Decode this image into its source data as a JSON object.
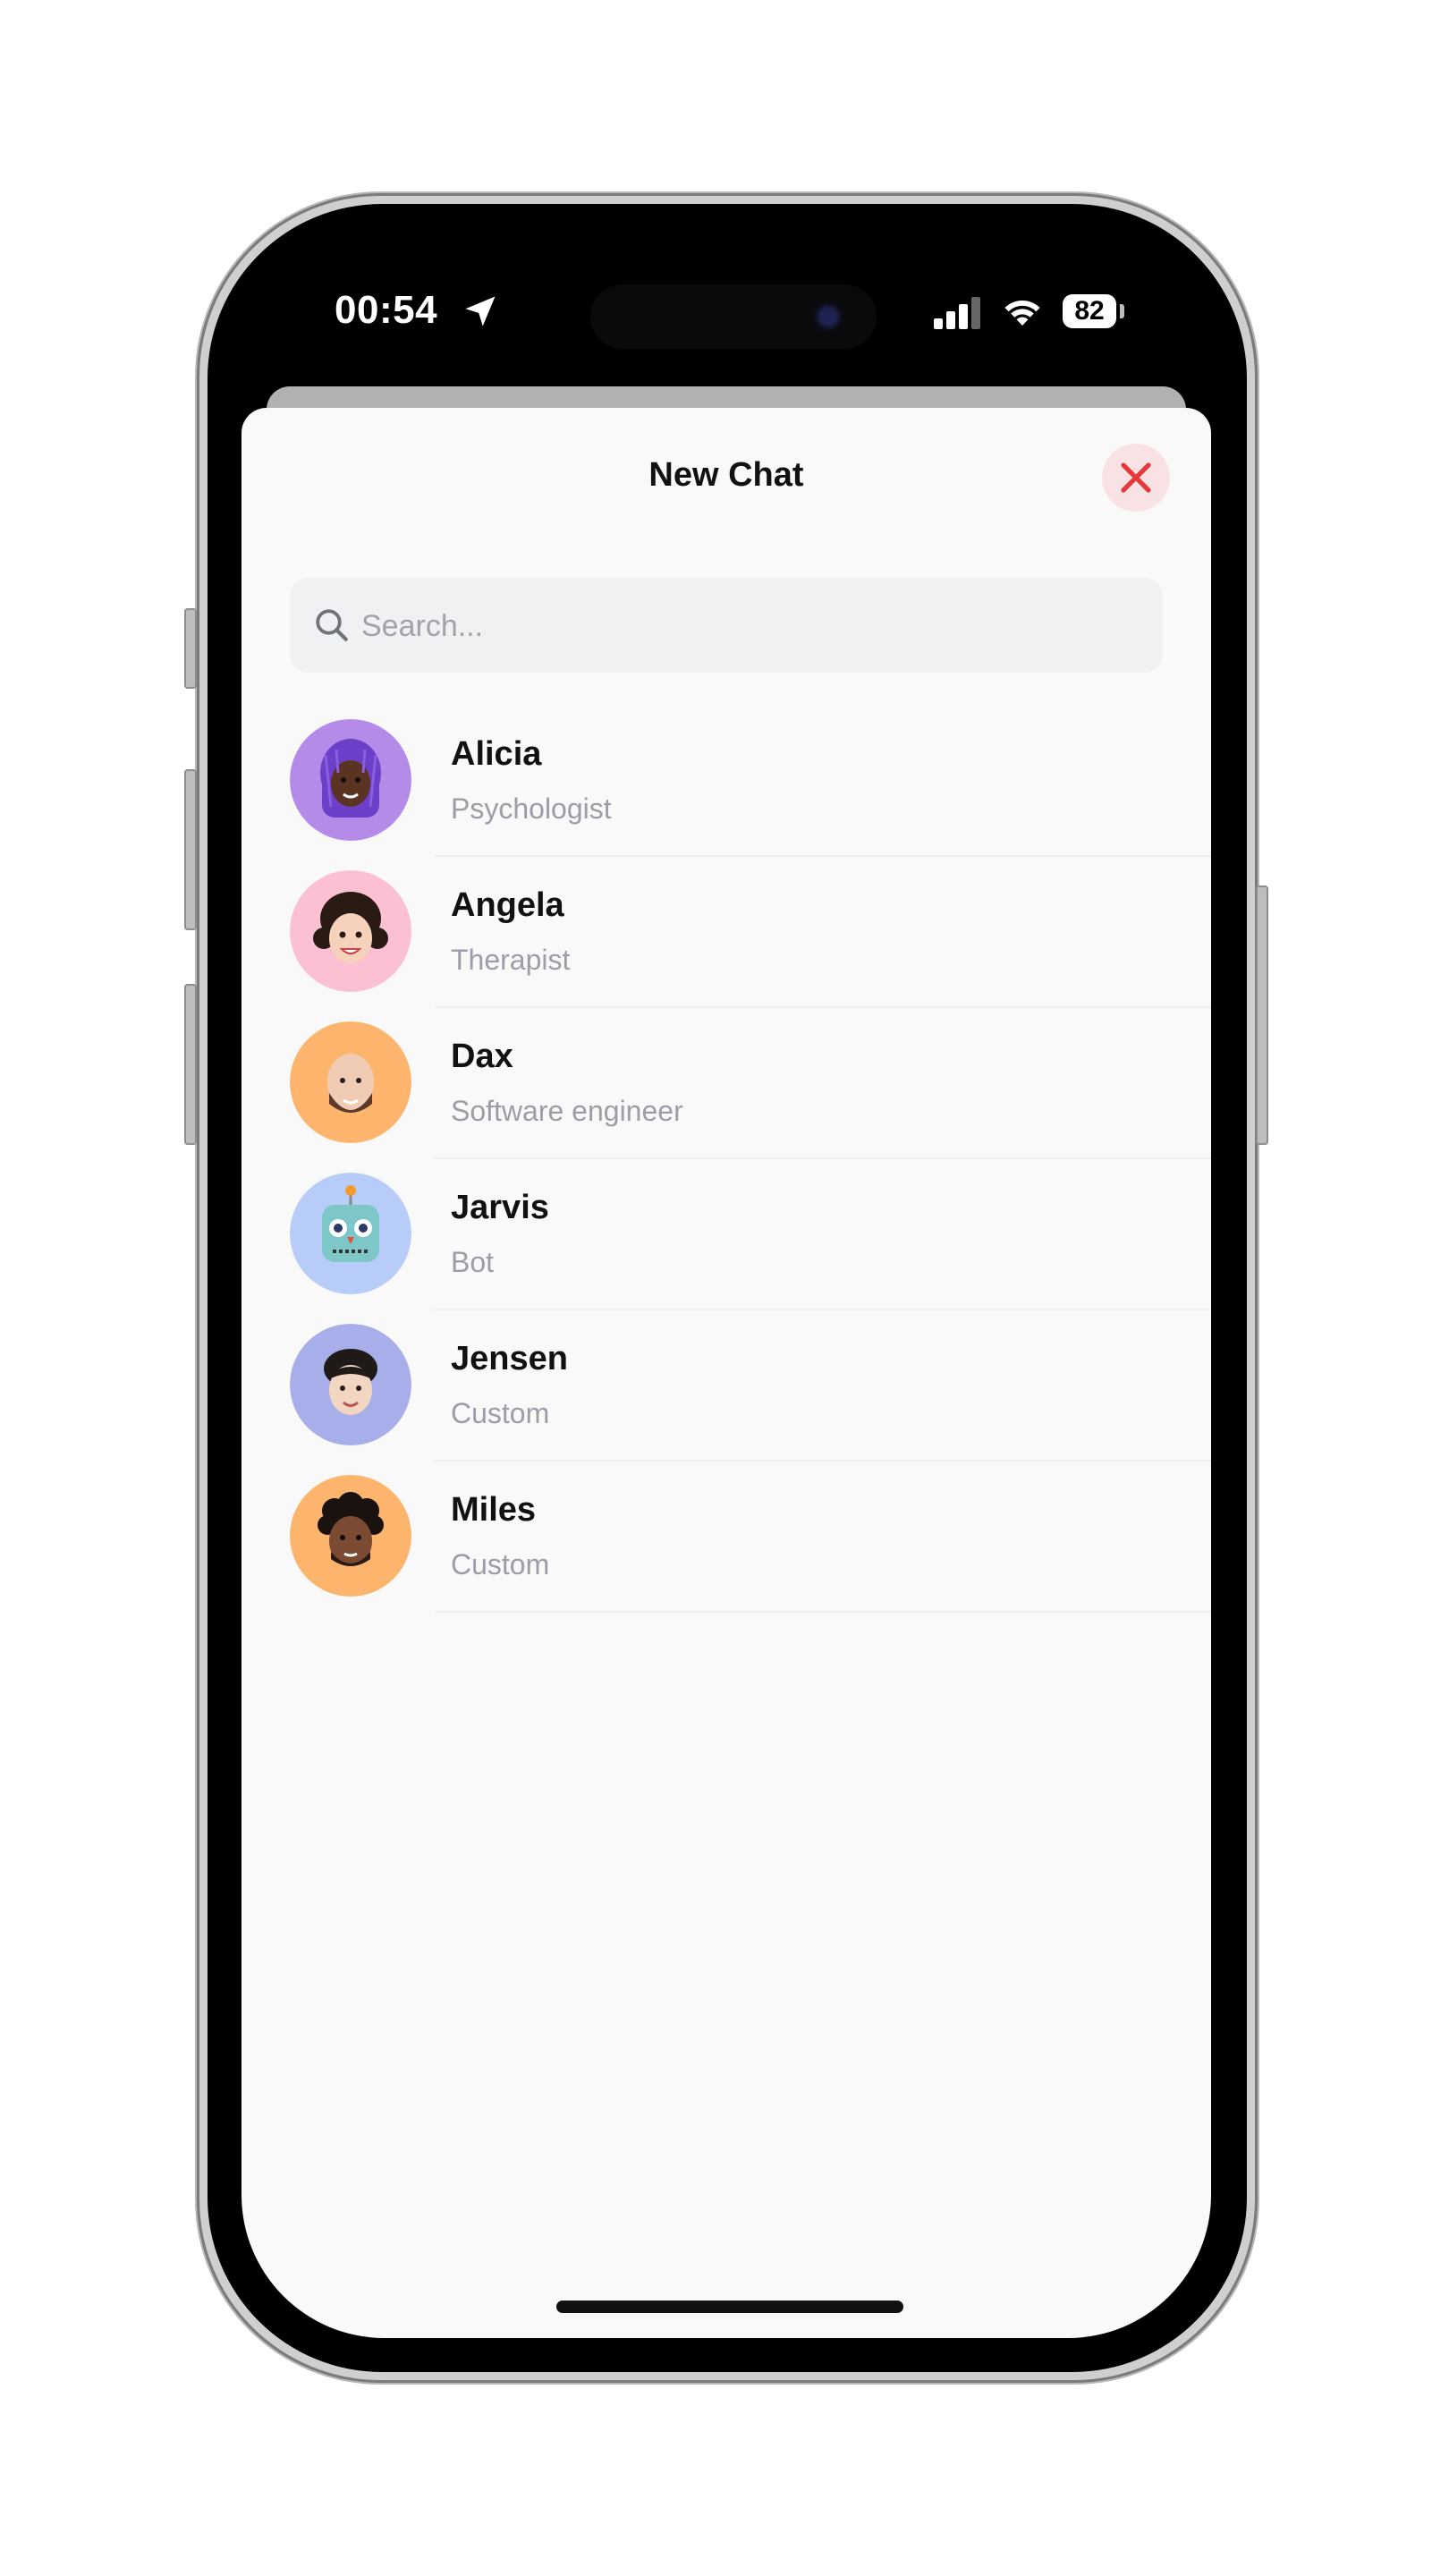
{
  "status_bar": {
    "time": "00:54",
    "battery_level": "82"
  },
  "sheet": {
    "title": "New Chat",
    "search_placeholder": "Search..."
  },
  "contacts": [
    {
      "name": "Alicia",
      "role": "Psychologist",
      "avatar_color": "#b48be8"
    },
    {
      "name": "Angela",
      "role": "Therapist",
      "avatar_color": "#fbc1d3"
    },
    {
      "name": "Dax",
      "role": "Software engineer",
      "avatar_color": "#fdb56e"
    },
    {
      "name": "Jarvis",
      "role": "Bot",
      "avatar_color": "#b7cdf7"
    },
    {
      "name": "Jensen",
      "role": "Custom",
      "avatar_color": "#a7aeea"
    },
    {
      "name": "Miles",
      "role": "Custom",
      "avatar_color": "#fdb56e"
    }
  ],
  "colors": {
    "close_accent": "#e5383b",
    "close_bg": "#f9e2e3",
    "sheet_bg": "#f9f9f9"
  }
}
